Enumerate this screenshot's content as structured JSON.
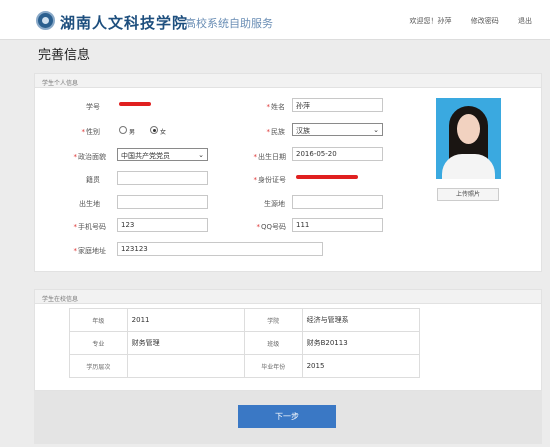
{
  "header": {
    "logo_text": "湖南人文科技学院",
    "subtitle": "高校系统自助服务",
    "links": [
      "欢迎您！孙萍",
      "修改密码",
      "退出"
    ]
  },
  "page_title": "完善信息",
  "personal": {
    "section_title": "学生个人信息",
    "labels": {
      "student_no": "学号",
      "name": "姓名",
      "gender": "性别",
      "ethnicity": "民族",
      "political": "政治面貌",
      "birth_date": "出生日期",
      "native_place": "籍贯",
      "id_number": "身份证号",
      "birthplace": "出生地",
      "origin": "生源地",
      "phone": "手机号码",
      "qq": "QQ号码",
      "address": "家庭地址"
    },
    "values": {
      "name": "孙萍",
      "ethnicity": "汉族",
      "political": "中国共产党党员",
      "birth_date": "2016-05-20",
      "native_place": "",
      "birthplace": "",
      "origin": "",
      "phone": "123",
      "qq": "111",
      "address": "123123"
    },
    "gender_options": [
      "男",
      "女"
    ],
    "gender_selected": "女",
    "upload_label": "上传照片"
  },
  "school": {
    "section_title": "学生在校信息",
    "rows": [
      {
        "k1": "年级",
        "v1": "2011",
        "k2": "学院",
        "v2": "经济与管理系"
      },
      {
        "k1": "专业",
        "v1": "财务管理",
        "k2": "班级",
        "v2": "财务B20113"
      },
      {
        "k1": "学历层次",
        "v1": "",
        "k2": "毕业年份",
        "v2": "2015"
      }
    ]
  },
  "next_button": "下一步"
}
